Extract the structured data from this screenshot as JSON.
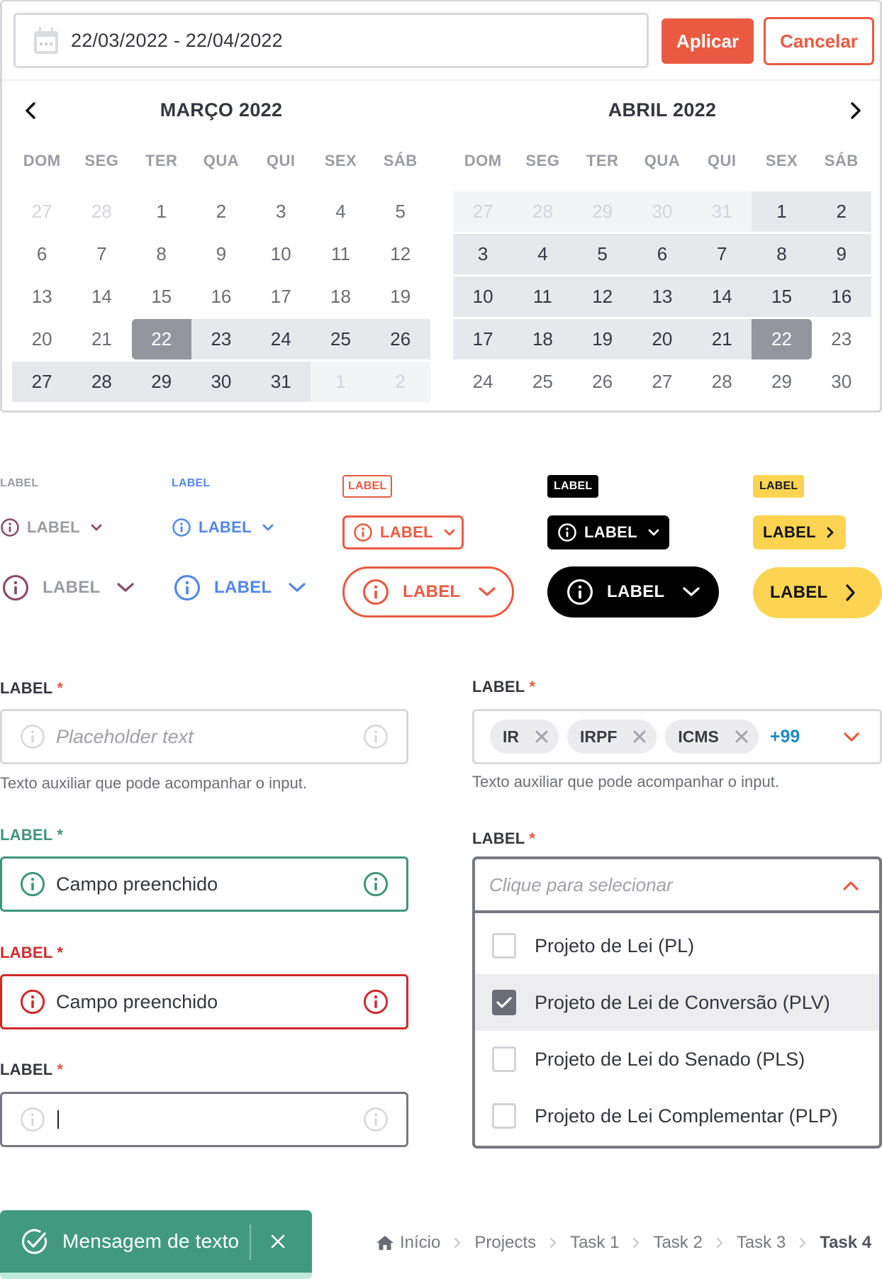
{
  "date_picker": {
    "range_value": "22/03/2022 - 22/04/2022",
    "apply_label": "Aplicar",
    "cancel_label": "Cancelar",
    "prev_icon": "chevron-left-icon",
    "next_icon": "chevron-right-icon",
    "weekdays": [
      "DOM",
      "SEG",
      "TER",
      "QUA",
      "QUI",
      "SEX",
      "SÁB"
    ],
    "months": [
      {
        "title": "MARÇO 2022",
        "weeks": [
          [
            {
              "d": "27",
              "s": "muted"
            },
            {
              "d": "28",
              "s": "muted"
            },
            {
              "d": "1",
              "s": ""
            },
            {
              "d": "2",
              "s": ""
            },
            {
              "d": "3",
              "s": ""
            },
            {
              "d": "4",
              "s": ""
            },
            {
              "d": "5",
              "s": ""
            }
          ],
          [
            {
              "d": "6",
              "s": ""
            },
            {
              "d": "7",
              "s": ""
            },
            {
              "d": "8",
              "s": ""
            },
            {
              "d": "9",
              "s": ""
            },
            {
              "d": "10",
              "s": ""
            },
            {
              "d": "11",
              "s": ""
            },
            {
              "d": "12",
              "s": ""
            }
          ],
          [
            {
              "d": "13",
              "s": ""
            },
            {
              "d": "14",
              "s": ""
            },
            {
              "d": "15",
              "s": ""
            },
            {
              "d": "16",
              "s": ""
            },
            {
              "d": "17",
              "s": ""
            },
            {
              "d": "18",
              "s": ""
            },
            {
              "d": "19",
              "s": ""
            }
          ],
          [
            {
              "d": "20",
              "s": ""
            },
            {
              "d": "21",
              "s": ""
            },
            {
              "d": "22",
              "s": "sel start"
            },
            {
              "d": "23",
              "s": "inrange"
            },
            {
              "d": "24",
              "s": "inrange"
            },
            {
              "d": "25",
              "s": "inrange"
            },
            {
              "d": "26",
              "s": "inrange"
            }
          ],
          [
            {
              "d": "27",
              "s": "inrange"
            },
            {
              "d": "28",
              "s": "inrange"
            },
            {
              "d": "29",
              "s": "inrange"
            },
            {
              "d": "30",
              "s": "inrange"
            },
            {
              "d": "31",
              "s": "inrange"
            },
            {
              "d": "1",
              "s": "inrange muted"
            },
            {
              "d": "2",
              "s": "inrange muted"
            }
          ]
        ]
      },
      {
        "title": "ABRIL 2022",
        "weeks": [
          [
            {
              "d": "27",
              "s": "inrange muted"
            },
            {
              "d": "28",
              "s": "inrange muted"
            },
            {
              "d": "29",
              "s": "inrange muted"
            },
            {
              "d": "30",
              "s": "inrange muted"
            },
            {
              "d": "31",
              "s": "inrange muted"
            },
            {
              "d": "1",
              "s": "inrange"
            },
            {
              "d": "2",
              "s": "inrange"
            }
          ],
          [
            {
              "d": "3",
              "s": "inrange"
            },
            {
              "d": "4",
              "s": "inrange"
            },
            {
              "d": "5",
              "s": "inrange"
            },
            {
              "d": "6",
              "s": "inrange"
            },
            {
              "d": "7",
              "s": "inrange"
            },
            {
              "d": "8",
              "s": "inrange"
            },
            {
              "d": "9",
              "s": "inrange"
            }
          ],
          [
            {
              "d": "10",
              "s": "inrange"
            },
            {
              "d": "11",
              "s": "inrange"
            },
            {
              "d": "12",
              "s": "inrange"
            },
            {
              "d": "13",
              "s": "inrange"
            },
            {
              "d": "14",
              "s": "inrange"
            },
            {
              "d": "15",
              "s": "inrange"
            },
            {
              "d": "16",
              "s": "inrange"
            }
          ],
          [
            {
              "d": "17",
              "s": "inrange"
            },
            {
              "d": "18",
              "s": "inrange"
            },
            {
              "d": "19",
              "s": "inrange"
            },
            {
              "d": "20",
              "s": "inrange"
            },
            {
              "d": "21",
              "s": "inrange"
            },
            {
              "d": "22",
              "s": "sel end"
            },
            {
              "d": "23",
              "s": ""
            }
          ],
          [
            {
              "d": "24",
              "s": ""
            },
            {
              "d": "25",
              "s": ""
            },
            {
              "d": "26",
              "s": ""
            },
            {
              "d": "27",
              "s": ""
            },
            {
              "d": "28",
              "s": ""
            },
            {
              "d": "29",
              "s": ""
            },
            {
              "d": "30",
              "s": ""
            }
          ]
        ]
      }
    ]
  },
  "tags": {
    "label": "LABEL",
    "colors": {
      "plain_text": "#9b9ca3",
      "plain_icon": "#8a4c68",
      "blue": "#5386ea",
      "red": "#ea5a42",
      "black": "#000000",
      "yellow": "#fdd451"
    }
  },
  "fields": {
    "required_mark": "*",
    "basic": {
      "label": "LABEL",
      "placeholder": "Placeholder text",
      "helper": "Texto auxiliar que pode acompanhar o input."
    },
    "success": {
      "label": "LABEL",
      "value": "Campo preenchido",
      "color": "#3e957a"
    },
    "error": {
      "label": "LABEL",
      "value": "Campo preenchido",
      "color": "#cf2a2a"
    },
    "focused": {
      "label": "LABEL",
      "value": ""
    },
    "multi": {
      "label": "LABEL",
      "chips": [
        "IR",
        "IRPF",
        "ICMS"
      ],
      "more": "+99",
      "helper": "Texto auxiliar que pode acompanhar o input."
    },
    "select": {
      "label": "LABEL",
      "placeholder": "Clique para selecionar",
      "options": [
        {
          "label": "Projeto de Lei (PL)",
          "checked": false
        },
        {
          "label": "Projeto de Lei de Conversão (PLV)",
          "checked": true
        },
        {
          "label": "Projeto de Lei do Senado (PLS)",
          "checked": false
        },
        {
          "label": "Projeto de Lei Complementar (PLP)",
          "checked": false
        }
      ]
    }
  },
  "toast": {
    "message": "Mensagem de texto",
    "icon": "check-circle-icon",
    "color": "#429a7e"
  },
  "breadcrumb": {
    "items": [
      "Início",
      "Projects",
      "Task 1",
      "Task 2",
      "Task 3"
    ],
    "current": "Task 4"
  }
}
